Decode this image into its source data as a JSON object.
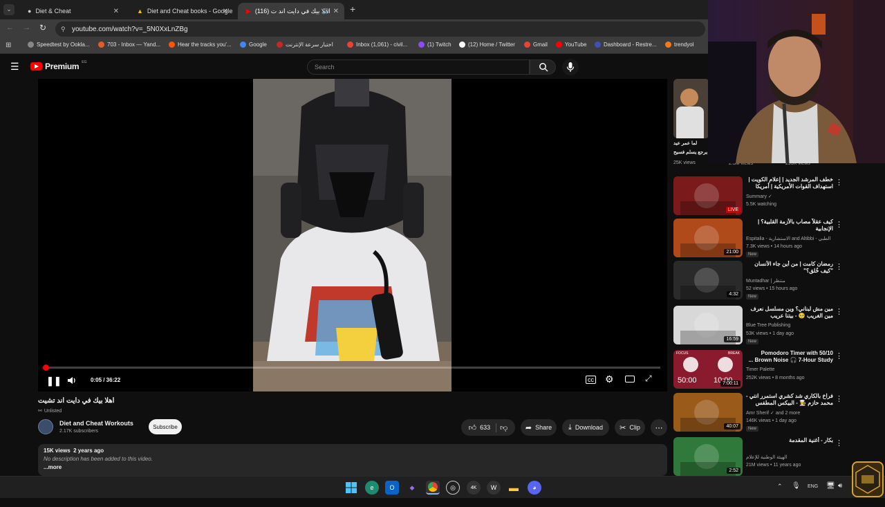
{
  "tabs": [
    {
      "title": "Diet & Cheat"
    },
    {
      "title": "Diet and Cheat books - Google"
    },
    {
      "title": "(116) اهلا بيك في دايت اند ت"
    }
  ],
  "address": {
    "url": "youtube.com/watch?v=_5N0XxLnZBg"
  },
  "bookmarks": [
    {
      "label": "Speedtest by Ookla...",
      "color": "#888888"
    },
    {
      "label": "703 - Inbox — Yand...",
      "color": "#e25c2a"
    },
    {
      "label": "Hear the tracks you'...",
      "color": "#ff5500"
    },
    {
      "label": "Google",
      "color": "#4285f4"
    },
    {
      "label": "اختبار سرعة الإنترنت",
      "color": "#c62828"
    },
    {
      "label": "Inbox (1,061) - civil...",
      "color": "#ea4335"
    },
    {
      "label": "(1) Twitch",
      "color": "#9146ff"
    },
    {
      "label": "(12) Home / Twitter",
      "color": "#ffffff"
    },
    {
      "label": "Gmail",
      "color": "#ea4335"
    },
    {
      "label": "YouTube",
      "color": "#ff0000"
    },
    {
      "label": "Dashboard - Restre...",
      "color": "#3f51b5"
    },
    {
      "label": "trendyol",
      "color": "#f27a1a"
    }
  ],
  "header": {
    "logo_text": "Premium",
    "region": "EG",
    "search_placeholder": "Search"
  },
  "player": {
    "time": "0:05 / 36:22",
    "progress_fraction": 0.002
  },
  "video": {
    "title": "اهلا بيك في دايت اند تشيت",
    "visibility": "Unlisted",
    "channel_name": "Diet and Cheat Workouts",
    "subscribers": "2.17K subscribers",
    "subscribe_label": "Subscribe",
    "likes": "633",
    "share_label": "Share",
    "download_label": "Download",
    "clip_label": "Clip"
  },
  "description": {
    "stats": "15K views  2 years ago",
    "text": "No description has been added to this video.",
    "more": "...more"
  },
  "top_rec": {
    "title_line1": "لما عمر عيد",
    "title_line2": "يرجع يسلم فسيح",
    "views": [
      "25K views",
      "2.3M views",
      "293K views"
    ]
  },
  "recommendations": [
    {
      "title": "خطف المرشد الجديد | إعلام الكويت | استهداف القوات الأمريكية | أمريكا تستعد بالنووي |",
      "channel": "Summary ✓",
      "meta": "5.5K watching",
      "badge": "",
      "duration": "LIVE",
      "thumb_color": "#7a1a1a"
    },
    {
      "title": "كيف عقلاً مصاب بالأزمة القلبية؟ | الإنجابية",
      "channel": "Espitalia - الاستشارية and Altibbi - الطبي",
      "meta": "7.3K views • 14 hours ago",
      "badge": "New",
      "duration": "21:00",
      "thumb_color": "#b04a1a"
    },
    {
      "title": "رمضان كامت | من أين جاء الأنسان \"كيف خُلق؟\"",
      "channel": "Muntadhar | منتظر",
      "meta": "52 views • 15 hours ago",
      "badge": "New",
      "duration": "4:32",
      "thumb_color": "#2a2a2a"
    },
    {
      "title": "مين مش لبناني؟ وين مسلسل نعرف مين الغريب 🥺 - بيتنا عريب",
      "channel": "Blue Tree Publishing",
      "meta": "53K views • 1 day ago",
      "badge": "New",
      "duration": "16:59",
      "thumb_color": "#d8d8d8"
    },
    {
      "title": "50/10 Pomodoro Timer with Brown Noise 🎧 7-Hour Study ...",
      "channel": "Timer Palette",
      "meta": "252K views • 8 months ago",
      "badge": "",
      "duration": "7:00:11",
      "thumb_color": "#8a1b2e"
    },
    {
      "title": "فراخ بالكاري شد كشري استمرر انتي - محمد حازم 👨‍🍳 - البيكس المطفس (**)",
      "channel": "Amr Sherif ✓ and 2 more",
      "meta": "146K views • 1 day ago",
      "badge": "New",
      "duration": "40:07",
      "thumb_color": "#9a5a1a"
    },
    {
      "title": "بكار - أغنية المقدمة",
      "channel": "الهيئة الوطنية للإعلام",
      "meta": "21M views • 11 years ago",
      "badge": "",
      "duration": "2:52",
      "thumb_color": "#2f7a3a"
    }
  ],
  "timer_thumb": {
    "left": "50:00",
    "right": "10:00",
    "focus": "FOCUS",
    "break": "BREAK"
  },
  "taskbar": {
    "lang": "ENG"
  },
  "colors": {
    "accent_red": "#ff0000",
    "bg": "#0f0f0f"
  }
}
